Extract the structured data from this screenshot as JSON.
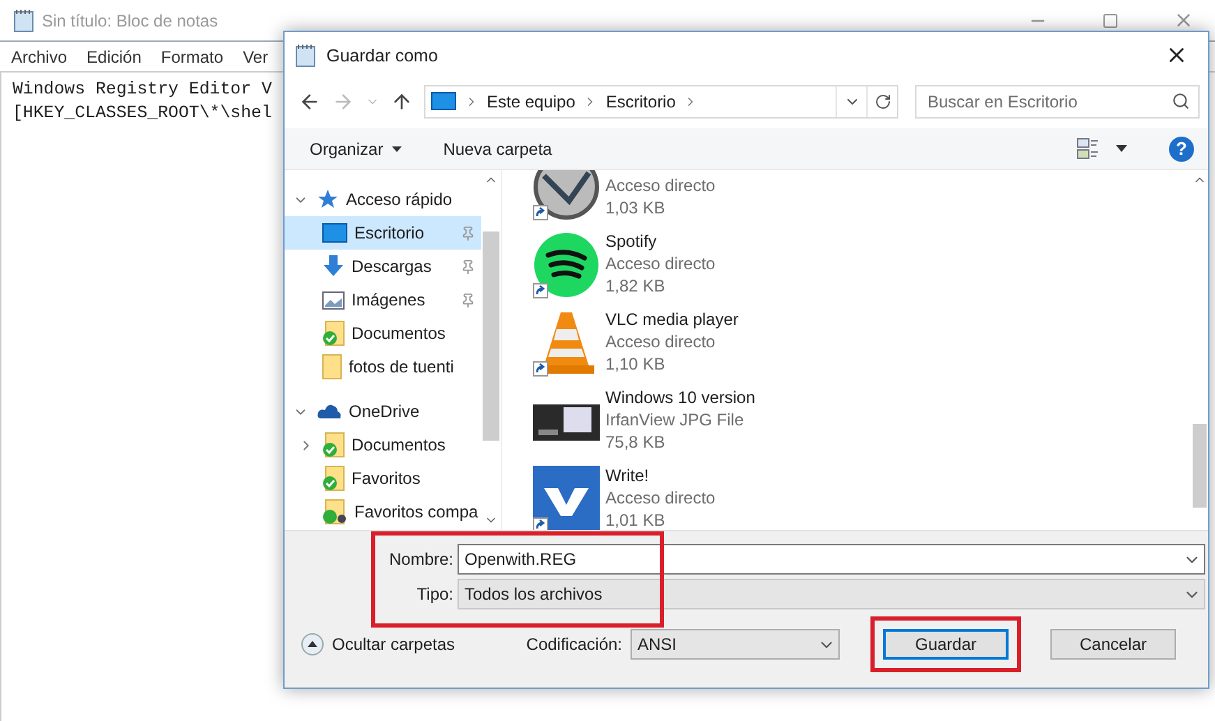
{
  "notepad": {
    "title": "Sin título: Bloc de notas",
    "menu": [
      "Archivo",
      "Edición",
      "Formato",
      "Ver"
    ],
    "lines": [
      "Windows Registry Editor V",
      "[HKEY_CLASSES_ROOT\\*\\shel"
    ]
  },
  "dialog": {
    "title": "Guardar como",
    "breadcrumbs": [
      "Este equipo",
      "Escritorio"
    ],
    "search": {
      "placeholder": "Buscar en Escritorio"
    },
    "toolbar": {
      "organize": "Organizar",
      "new_folder": "Nueva carpeta",
      "help": "?"
    },
    "sidebar": {
      "items": [
        {
          "label": "Acceso rápido",
          "kind": "star",
          "expanded": true,
          "children": [
            {
              "label": "Escritorio",
              "kind": "desktop",
              "selected": true,
              "pinned": true
            },
            {
              "label": "Descargas",
              "kind": "download",
              "selected": false,
              "pinned": true
            },
            {
              "label": "Imágenes",
              "kind": "pictures",
              "selected": false,
              "pinned": true
            },
            {
              "label": "Documentos",
              "kind": "synced-folder",
              "selected": false,
              "pinned": false
            },
            {
              "label": "fotos de tuenti",
              "kind": "folder",
              "selected": false,
              "pinned": false
            }
          ]
        },
        {
          "label": "OneDrive",
          "kind": "cloud",
          "expanded": true,
          "children": [
            {
              "label": "Documentos",
              "kind": "synced-folder",
              "selected": false,
              "pinned": false,
              "expandable": true
            },
            {
              "label": "Favoritos",
              "kind": "synced-folder",
              "selected": false,
              "pinned": false,
              "expandable": false
            },
            {
              "label": "Favoritos compa",
              "kind": "shared-folder",
              "selected": false,
              "pinned": false,
              "expandable": false
            }
          ]
        }
      ]
    },
    "files": [
      {
        "kind": "film",
        "shortcut": true,
        "type": "Acceso directo",
        "size": "1,03 KB"
      },
      {
        "kind": "music",
        "name": "Spotify",
        "shortcut": true,
        "type": "Acceso directo",
        "size": "1,82 KB"
      },
      {
        "kind": "cone",
        "name": "VLC media player",
        "shortcut": true,
        "type": "Acceso directo",
        "size": "1,10 KB"
      },
      {
        "kind": "screenshot",
        "name": "Windows 10 version",
        "shortcut": false,
        "type": "IrfanView JPG File",
        "size": "75,8 KB"
      },
      {
        "kind": "letter",
        "name": "Write!",
        "shortcut": true,
        "type": "Acceso directo",
        "size": "1,01 KB"
      }
    ],
    "form": {
      "highlighted": true,
      "name_label": "Nombre:",
      "name_value": "Openwith.REG",
      "type_label": "Tipo:",
      "type_value": "Todos los archivos"
    },
    "footer": {
      "hide_folders": "Ocultar carpetas",
      "encoding_label": "Codificación:",
      "encoding_value": "ANSI",
      "buttons": [
        {
          "label": "Guardar",
          "default": true,
          "highlighted": true
        },
        {
          "label": "Cancelar",
          "default": false,
          "highlighted": false
        }
      ]
    }
  }
}
